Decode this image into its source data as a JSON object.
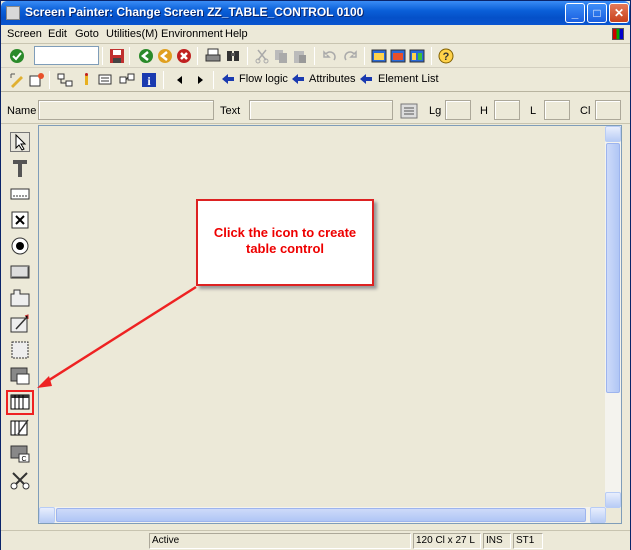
{
  "window": {
    "title": "Screen Painter:  Change Screen ZZ_TABLE_CONTROL 0100",
    "buttons": {
      "minimize": "_",
      "maximize": "□",
      "close": "✕"
    }
  },
  "menu": {
    "items": [
      "Screen",
      "Edit",
      "Goto",
      "Utilities(M)",
      "Environment",
      "Help"
    ]
  },
  "toolbar": {
    "nav": {
      "flow_logic": "Flow logic",
      "attributes": "Attributes",
      "element_list": "Element List"
    }
  },
  "fields": {
    "name_label": "Name",
    "text_label": "Text",
    "lg_label": "Lg",
    "h_label": "H",
    "l_label": "L",
    "cl_label": "Cl"
  },
  "palette": {
    "items": [
      "select-pointer-icon",
      "text-field-icon",
      "input-output-field-icon",
      "checkbox-icon",
      "radio-button-icon",
      "pushbutton-icon",
      "tabstrip-icon",
      "tabstrip-wizard-icon",
      "box-icon",
      "subscreen-icon",
      "table-control-icon",
      "table-control-wizard-icon",
      "custom-control-icon",
      "status-icon"
    ]
  },
  "callout": {
    "line1": "Click the icon to create",
    "line2": "table control",
    "color": "#ee0000"
  },
  "statusbar": {
    "status": "Active",
    "size": "120 Cl x 27 L",
    "mode": "INS",
    "system": "ST1"
  }
}
